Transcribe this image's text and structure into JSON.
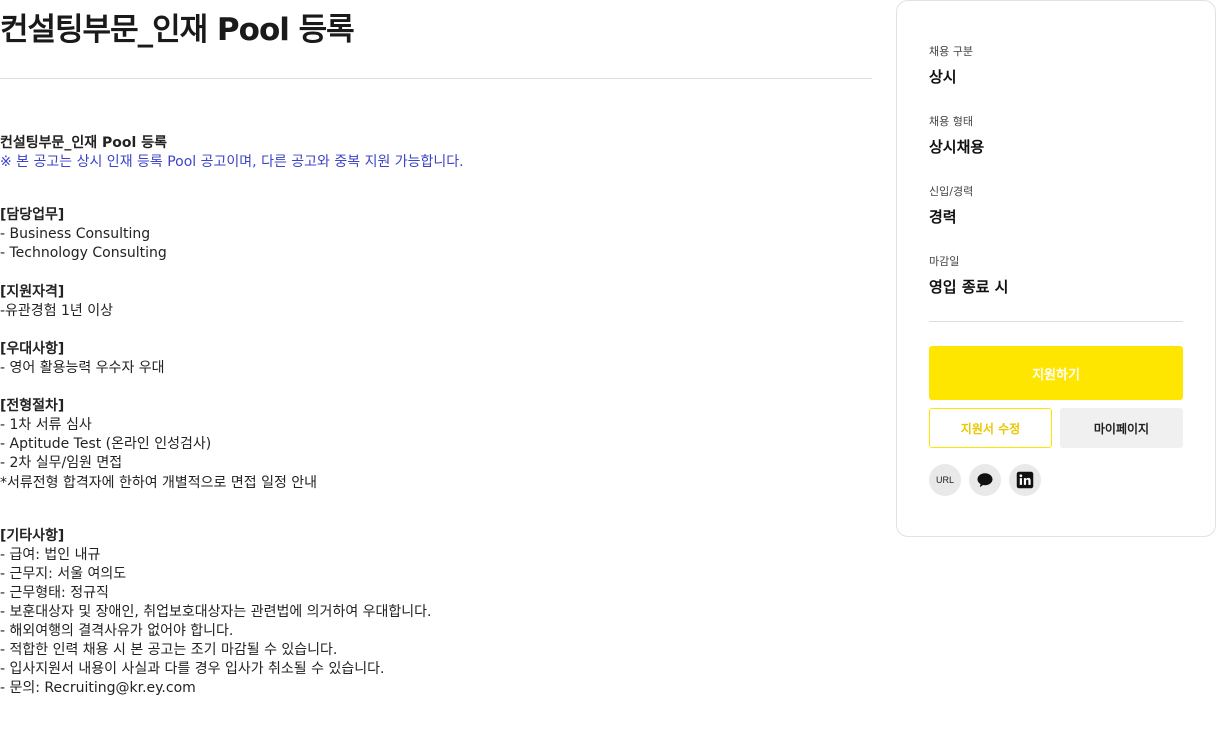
{
  "page_title": "컨설팅부문_인재 Pool 등록",
  "content": {
    "heading": "컨설팅부문_인재 Pool 등록",
    "notice": "※ 본 공고는 상시 인재 등록 Pool 공고이며, 다른 공고와 중복 지원 가능합니다.",
    "duties": {
      "title": "[담당업무]",
      "items": [
        "- Business Consulting",
        "- Technology Consulting"
      ]
    },
    "qualifications": {
      "title": "[지원자격]",
      "items": [
        "-유관경험 1년 이상"
      ]
    },
    "preferences": {
      "title": "[우대사항]",
      "items": [
        "- 영어 활용능력 우수자 우대"
      ]
    },
    "process": {
      "title": "[전형절차]",
      "items": [
        "- 1차 서류 심사",
        "- Aptitude Test (온라인 인성검사)",
        "- 2차 실무/임원 면접",
        "*서류전형 합격자에 한하여 개별적으로 면접 일정 안내"
      ]
    },
    "others": {
      "title": "[기타사항]",
      "items": [
        "- 급여: 법인 내규",
        "- 근무지: 서울 여의도",
        "- 근무형태: 정규직",
        "- 보훈대상자 및 장애인, 취업보호대상자는 관련법에 의거하여 우대합니다.",
        "- 해외여행의 결격사유가 없어야 합니다.",
        "- 적합한 인력 채용 시 본 공고는 조기 마감될 수 있습니다.",
        "- 입사지원서 내용이 사실과 다를 경우 입사가 취소될 수 있습니다.",
        "- 문의: Recruiting@kr.ey.com"
      ]
    }
  },
  "sidebar": {
    "info": [
      {
        "label": "채용 구분",
        "value": "상시"
      },
      {
        "label": "채용 형태",
        "value": "상시채용"
      },
      {
        "label": "신입/경력",
        "value": "경력"
      },
      {
        "label": "마감일",
        "value": "영입 종료 시"
      }
    ],
    "apply_label": "지원하기",
    "edit_label": "지원서 수정",
    "mypage_label": "마이페이지",
    "share": {
      "url_label": "URL",
      "icons": [
        "link-url-icon",
        "chat-bubble-icon",
        "linkedin-icon"
      ]
    }
  },
  "colors": {
    "accent": "#ffe600",
    "notice_text": "#3d44c8",
    "secondary_button": "#f0f0f0"
  }
}
